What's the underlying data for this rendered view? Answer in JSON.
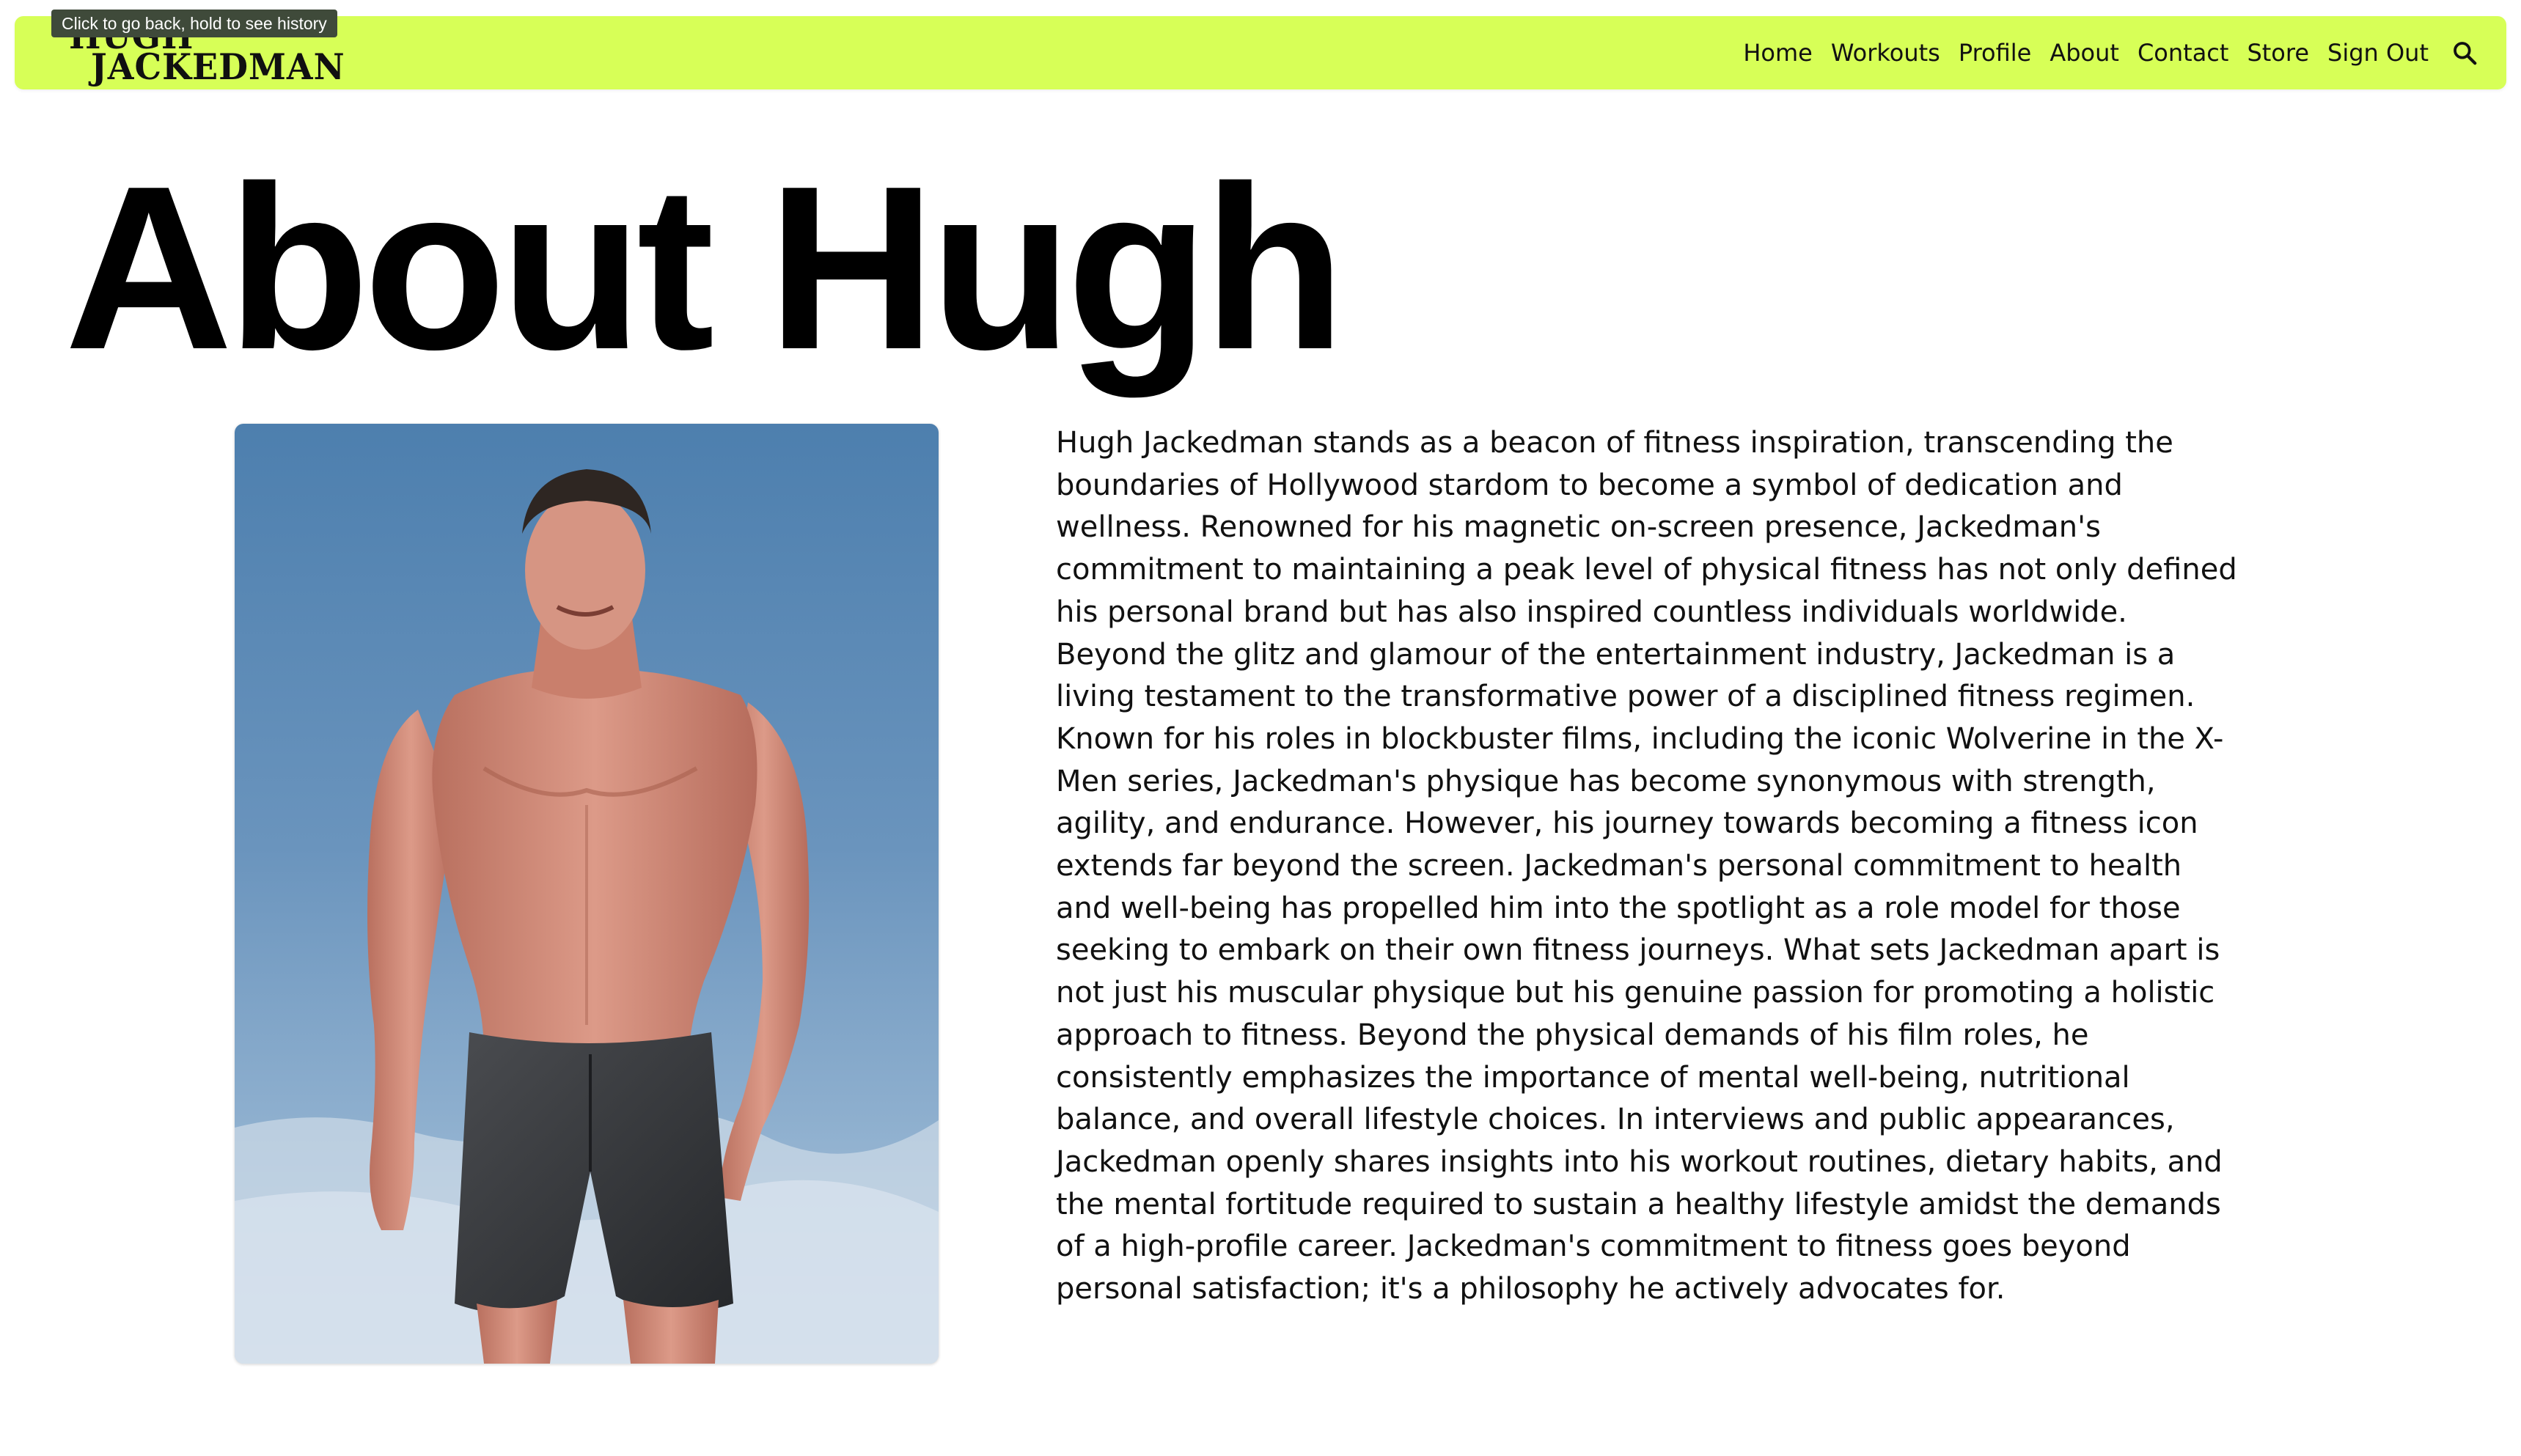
{
  "browser": {
    "back_tooltip": "Click to go back, hold to see history"
  },
  "header": {
    "logo_line1": "HUGH",
    "logo_line2": "JACKEDMAN",
    "nav": [
      {
        "label": "Home"
      },
      {
        "label": "Workouts"
      },
      {
        "label": "Profile"
      },
      {
        "label": "About"
      },
      {
        "label": "Contact"
      },
      {
        "label": "Store"
      },
      {
        "label": "Sign Out"
      }
    ],
    "search_icon": "search-icon",
    "bar_color": "#d7ff57"
  },
  "main": {
    "title": "About Hugh",
    "photo_icon": "portrait-photo",
    "bio": "Hugh Jackedman stands as a beacon of fitness inspiration, transcending the boundaries of Hollywood stardom to become a symbol of dedication and wellness. Renowned for his magnetic on-screen presence, Jackedman's commitment to maintaining a peak level of physical fitness has not only defined his personal brand but has also inspired countless individuals worldwide. Beyond the glitz and glamour of the entertainment industry, Jackedman is a living testament to the transformative power of a disciplined fitness regimen. Known for his roles in blockbuster films, including the iconic Wolverine in the X-Men series, Jackedman's physique has become synonymous with strength, agility, and endurance. However, his journey towards becoming a fitness icon extends far beyond the screen. Jackedman's personal commitment to health and well-being has propelled him into the spotlight as a role model for those seeking to embark on their own fitness journeys. What sets Jackedman apart is not just his muscular physique but his genuine passion for promoting a holistic approach to fitness. Beyond the physical demands of his film roles, he consistently emphasizes the importance of mental well-being, nutritional balance, and overall lifestyle choices. In interviews and public appearances, Jackedman openly shares insights into his workout routines, dietary habits, and the mental fortitude required to sustain a healthy lifestyle amidst the demands of a high-profile career. Jackedman's commitment to fitness goes beyond personal satisfaction; it's a philosophy he actively advocates for."
  }
}
